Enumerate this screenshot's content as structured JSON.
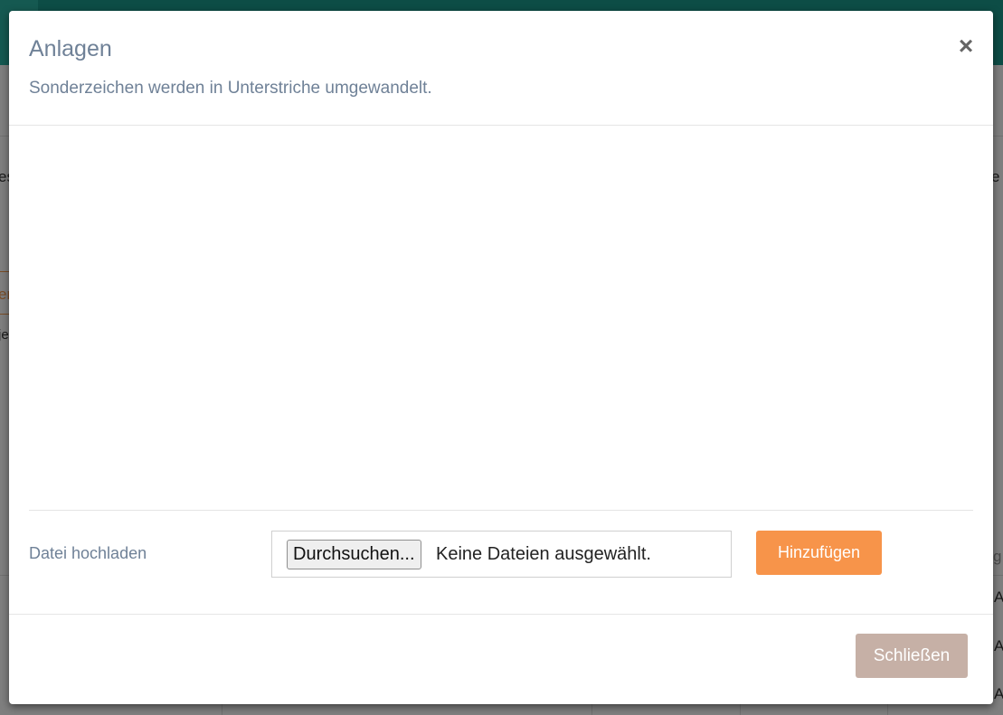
{
  "modal": {
    "title": "Anlagen",
    "subtitle": "Sonderzeichen werden in Unterstriche umgewandelt.",
    "close_icon": "×",
    "upload": {
      "label": "Datei hochladen",
      "browse_button": "Durchsuchen...",
      "file_status": "Keine Dateien ausgewählt.",
      "add_button": "Hinzufügen"
    },
    "footer": {
      "close_button": "Schließen"
    }
  },
  "background": {
    "fragments": [
      "es",
      "e",
      "er",
      "je",
      "g",
      "A",
      "A",
      "A"
    ]
  },
  "colors": {
    "accent_orange": "#f7944a",
    "close_button": "#c6b0a6",
    "title_text": "#6f8197",
    "topbar_teal": "#1a9a8c"
  }
}
